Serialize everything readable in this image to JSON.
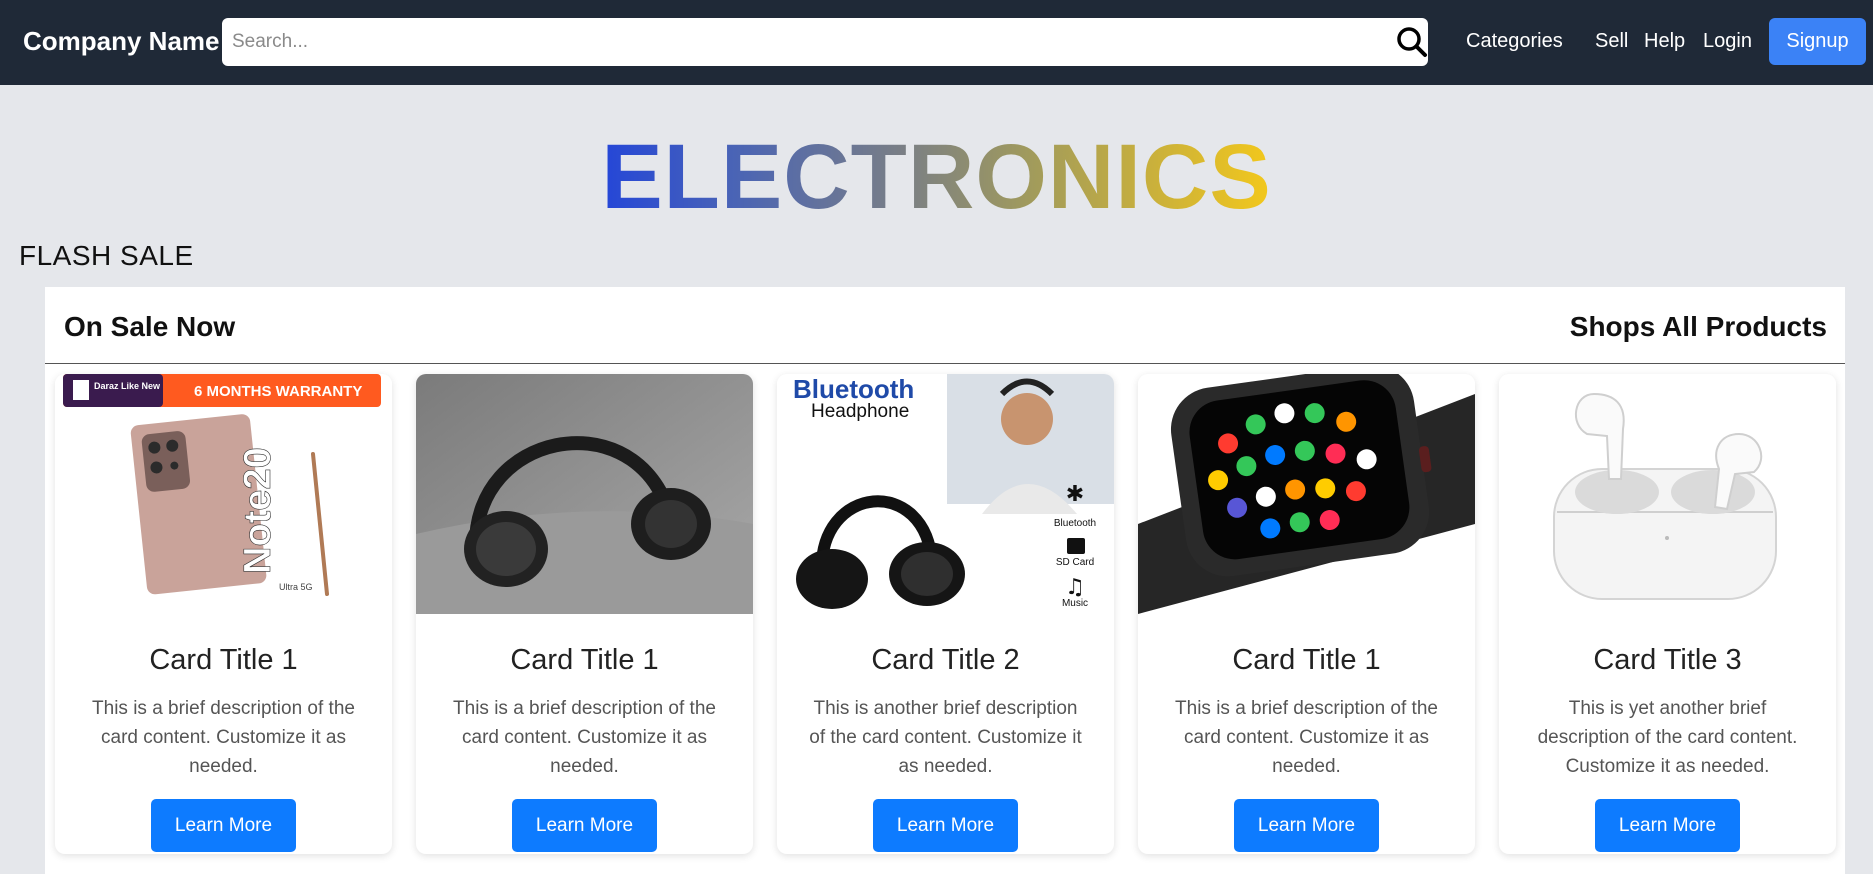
{
  "navbar": {
    "brand": "Company Name",
    "search_placeholder": "Search...",
    "links": [
      "Categories",
      "Sell",
      "Help",
      "Login"
    ],
    "signup": "Signup",
    "background": "#1f2937",
    "accent": "#3b82f6"
  },
  "hero": {
    "title": "ELECTRONICS",
    "gradient": [
      "#2446d8",
      "#f3c81b"
    ]
  },
  "section": {
    "label": "FLASH SALE"
  },
  "panel": {
    "left_title": "On Sale Now",
    "right_title": "Shops All Products"
  },
  "cards": [
    {
      "image": "samsung-note20-phone",
      "banner_brand": "Daraz Like New",
      "banner_text": "6 MONTHS WARRANTY",
      "phone_text": "Note20",
      "phone_sub": "Ultra 5G",
      "title": "Card Title 1",
      "text": "This is a brief description of the card content. Customize it as needed.",
      "button": "Learn More"
    },
    {
      "image": "black-headphones-on-sofa",
      "title": "Card Title 1",
      "text": "This is a brief description of the card content. Customize it as needed.",
      "button": "Learn More"
    },
    {
      "image": "bluetooth-headphone-ad",
      "ad_title": "Bluetooth",
      "ad_sub": "Headphone",
      "features": [
        "Bluetooth",
        "SD Card",
        "Music"
      ],
      "title": "Card Title 2",
      "text": "This is another brief description of the card content. Customize it as needed.",
      "button": "Learn More"
    },
    {
      "image": "smart-watch",
      "title": "Card Title 1",
      "text": "This is a brief description of the card content. Customize it as needed.",
      "button": "Learn More"
    },
    {
      "image": "wireless-earbuds",
      "title": "Card Title 3",
      "text": "This is yet another brief description of the card content. Customize it as needed.",
      "button": "Learn More"
    }
  ],
  "colors": {
    "page_background": "#e5e7eb",
    "button": "#0d7bff"
  }
}
